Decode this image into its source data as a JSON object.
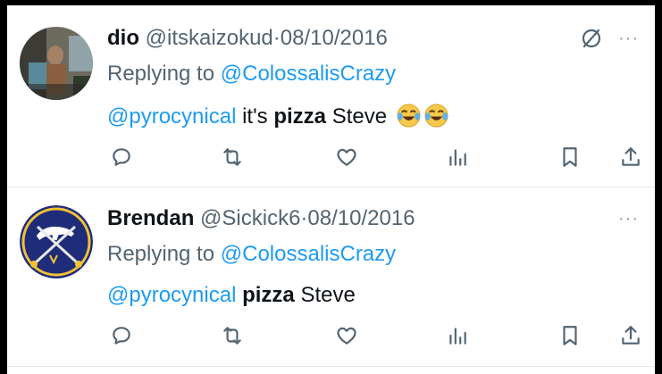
{
  "tweets": [
    {
      "display_name": "dio",
      "handle": "@itskaizokud",
      "separator": "·",
      "date": "08/10/2016",
      "reply_prefix": "Replying to",
      "reply_to": "@ColossalisCrazy",
      "mention": "@pyrocynical",
      "text_before": " it's ",
      "bold_word": "pizza",
      "text_after": " Steve",
      "emoji": "😂😂",
      "more_label": "···"
    },
    {
      "display_name": "Brendan",
      "handle": "@Sickick6",
      "separator": "·",
      "date": "08/10/2016",
      "reply_prefix": "Replying to",
      "reply_to": "@ColossalisCrazy",
      "mention": "@pyrocynical",
      "text_before": " ",
      "bold_word": "pizza",
      "text_after": " Steve",
      "more_label": "···"
    }
  ],
  "icons": {
    "reply": "reply-icon",
    "retweet": "retweet-icon",
    "like": "like-icon",
    "views": "views-icon",
    "bookmark": "bookmark-icon",
    "share": "share-icon",
    "grok_off": "no-entry-icon"
  },
  "colors": {
    "link": "#1d9bf0",
    "text": "#0f1419",
    "muted": "#536471"
  }
}
